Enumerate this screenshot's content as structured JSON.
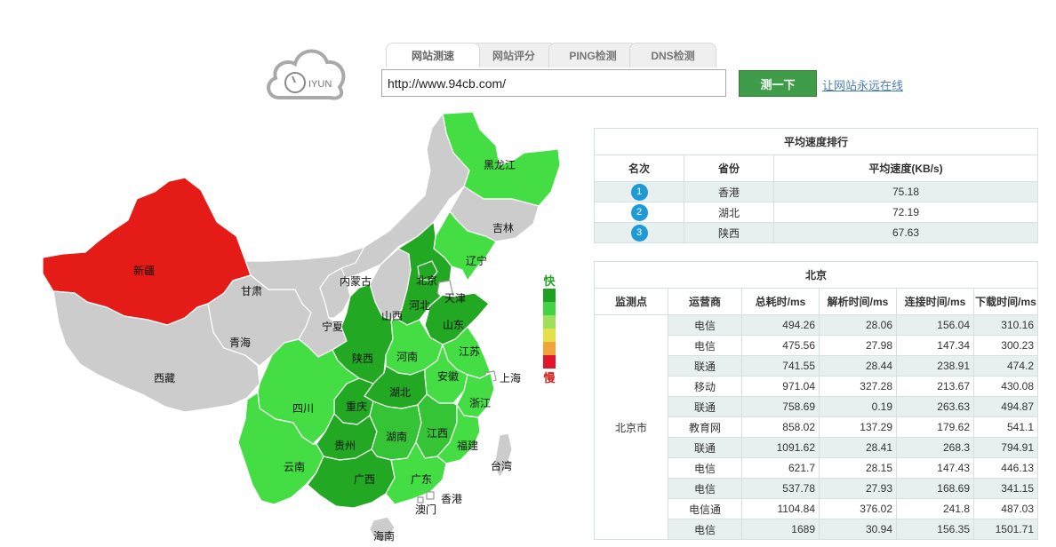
{
  "logo": {
    "text": "IYUN"
  },
  "tabs": [
    {
      "label": "网站测速",
      "active": true
    },
    {
      "label": "网站评分",
      "active": false
    },
    {
      "label": "PING检测",
      "active": false
    },
    {
      "label": "DNS检测",
      "active": false
    }
  ],
  "search": {
    "value": "http://www.94cb.com/"
  },
  "test_button": "测一下",
  "promo_link": "让网站永远在线",
  "legend": {
    "fast": "快",
    "slow": "慢",
    "colors": [
      "#20a020",
      "#41d341",
      "#9fe05a",
      "#e3e04c",
      "#f0a43a",
      "#e0162a"
    ]
  },
  "map_colors": {
    "gray": "#cccccc",
    "xinjiang": "#e41b17",
    "green_light": "#44dd44",
    "green_mid": "#35c435",
    "green_dark": "#22a822"
  },
  "provinces": [
    {
      "name": "新疆",
      "color": "#e41b17"
    },
    {
      "name": "西藏",
      "color": "#cccccc"
    },
    {
      "name": "青海",
      "color": "#cccccc"
    },
    {
      "name": "甘肃",
      "color": "#cccccc"
    },
    {
      "name": "内蒙古",
      "color": "#cccccc"
    },
    {
      "name": "宁夏",
      "color": "#cccccc"
    },
    {
      "name": "山西",
      "color": "#cccccc"
    },
    {
      "name": "吉林",
      "color": "#cccccc"
    },
    {
      "name": "台湾",
      "color": "#cccccc"
    },
    {
      "name": "海南",
      "color": "#cccccc"
    },
    {
      "name": "黑龙江",
      "color": "#44dd44"
    },
    {
      "name": "辽宁",
      "color": "#44dd44"
    },
    {
      "name": "北京",
      "color": "#22a822"
    },
    {
      "name": "天津",
      "color": "#ffffff"
    },
    {
      "name": "河北",
      "color": "#22a822"
    },
    {
      "name": "山东",
      "color": "#22a822"
    },
    {
      "name": "陕西",
      "color": "#22a822"
    },
    {
      "name": "河南",
      "color": "#44dd44"
    },
    {
      "name": "江苏",
      "color": "#44dd44"
    },
    {
      "name": "安徽",
      "color": "#44dd44"
    },
    {
      "name": "上海",
      "color": "#ffffff"
    },
    {
      "name": "湖北",
      "color": "#22a822"
    },
    {
      "name": "四川",
      "color": "#44dd44"
    },
    {
      "name": "重庆",
      "color": "#22a822"
    },
    {
      "name": "浙江",
      "color": "#44dd44"
    },
    {
      "name": "贵州",
      "color": "#22a822"
    },
    {
      "name": "湖南",
      "color": "#35c435"
    },
    {
      "name": "江西",
      "color": "#35c435"
    },
    {
      "name": "福建",
      "color": "#44dd44"
    },
    {
      "name": "云南",
      "color": "#44dd44"
    },
    {
      "name": "广西",
      "color": "#22a822"
    },
    {
      "name": "广东",
      "color": "#44dd44"
    },
    {
      "name": "香港",
      "color": "#ffffff"
    },
    {
      "name": "澳门",
      "color": "#ffffff"
    }
  ],
  "ranking": {
    "title": "平均速度排行",
    "headers": [
      "名次",
      "省份",
      "平均速度(KB/s)"
    ],
    "rows": [
      {
        "rank": "1",
        "province": "香港",
        "speed": "75.18"
      },
      {
        "rank": "2",
        "province": "湖北",
        "speed": "72.19"
      },
      {
        "rank": "3",
        "province": "陕西",
        "speed": "67.63"
      }
    ]
  },
  "detail": {
    "title": "北京",
    "headers": [
      "监测点",
      "运营商",
      "总耗时/ms",
      "解析时间/ms",
      "连接时间/ms",
      "下载时间/ms"
    ],
    "city": "北京市",
    "rows": [
      {
        "isp": "电信",
        "total": "494.26",
        "dns": "28.06",
        "connect": "156.04",
        "download": "310.16"
      },
      {
        "isp": "电信",
        "total": "475.56",
        "dns": "27.98",
        "connect": "147.34",
        "download": "300.23"
      },
      {
        "isp": "联通",
        "total": "741.55",
        "dns": "28.44",
        "connect": "238.91",
        "download": "474.2"
      },
      {
        "isp": "移动",
        "total": "971.04",
        "dns": "327.28",
        "connect": "213.67",
        "download": "430.08"
      },
      {
        "isp": "联通",
        "total": "758.69",
        "dns": "0.19",
        "connect": "263.63",
        "download": "494.87"
      },
      {
        "isp": "教育网",
        "total": "858.02",
        "dns": "137.29",
        "connect": "179.62",
        "download": "541.1"
      },
      {
        "isp": "联通",
        "total": "1091.62",
        "dns": "28.41",
        "connect": "268.3",
        "download": "794.91"
      },
      {
        "isp": "电信",
        "total": "621.7",
        "dns": "28.15",
        "connect": "147.43",
        "download": "446.13"
      },
      {
        "isp": "电信",
        "total": "537.78",
        "dns": "27.93",
        "connect": "168.69",
        "download": "341.15"
      },
      {
        "isp": "电信通",
        "total": "1104.84",
        "dns": "376.02",
        "connect": "241.8",
        "download": "487.03"
      },
      {
        "isp": "电信",
        "total": "1689",
        "dns": "30.94",
        "connect": "156.35",
        "download": "1501.71"
      }
    ]
  }
}
